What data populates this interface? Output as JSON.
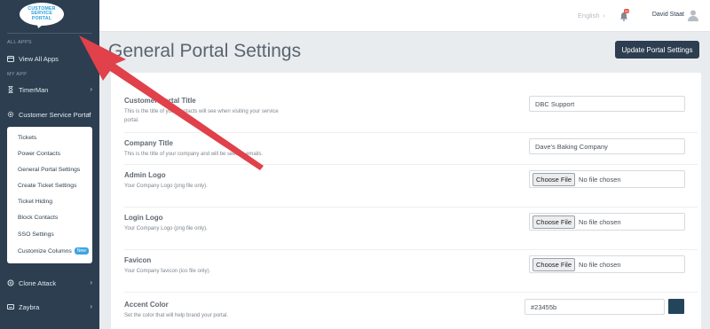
{
  "sidebar": {
    "logo_lines": [
      "CUSTOMER",
      "SERVICE",
      "PORTAL"
    ],
    "section_all_apps": "ALL APPS",
    "view_all_apps": "View All Apps",
    "section_my_app": "MY APP",
    "timerman": "TimerMan",
    "customer_service_portal": "Customer Service Portal",
    "submenu": [
      "Tickets",
      "Power Contacts",
      "General Portal Settings",
      "Create Ticket Settings",
      "Ticket Hiding",
      "Block Contacts",
      "SSO Settings",
      "Customize Columns"
    ],
    "new_badge": "New",
    "clone_attack": "Clone Attack",
    "zaybra": "Zaybra"
  },
  "topbar": {
    "language": "English",
    "language_chevron": "›",
    "notification_count": "99",
    "user_name": "David Staat"
  },
  "page": {
    "title": "General Portal Settings",
    "update_button": "Update Portal Settings"
  },
  "settings": {
    "portal_title": {
      "label": "Customer Portal Title",
      "desc": "This is the title of your contacts will see when visiting your service portal.",
      "value": "DBC Support"
    },
    "company_title": {
      "label": "Company Title",
      "desc": "This is the title of your company and will be seen in emails.",
      "value": "Dave's Baking Company"
    },
    "admin_logo": {
      "label": "Admin Logo",
      "desc": "Your Company Logo (png file only).",
      "button": "Choose File",
      "status": "No file chosen"
    },
    "login_logo": {
      "label": "Login Logo",
      "desc": "Your Company Logo (png file only).",
      "button": "Choose File",
      "status": "No file chosen"
    },
    "favicon": {
      "label": "Favicon",
      "desc": "Your Company favicon (ico file only).",
      "button": "Choose File",
      "status": "No file chosen"
    },
    "accent_color": {
      "label": "Accent Color",
      "desc": "Set the color that will help brand your portal.",
      "value": "#23455b",
      "swatch_color": "#23455b"
    }
  },
  "colors": {
    "sidebar_bg": "#2c3e50",
    "annotation_arrow": "#e0414a",
    "badge_new": "#3da4e0"
  }
}
